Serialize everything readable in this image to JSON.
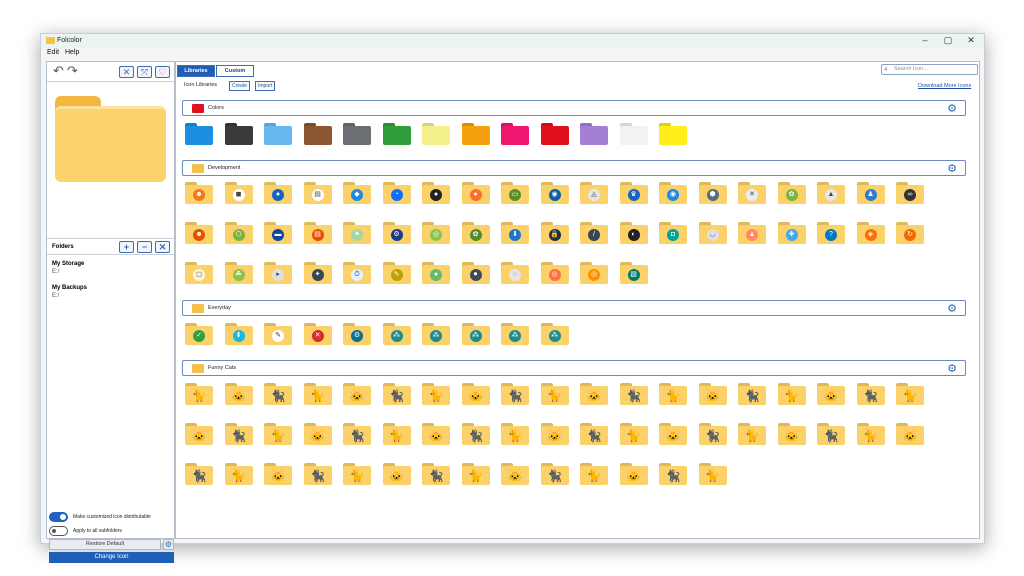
{
  "window": {
    "title": "Folcolor",
    "min": "–",
    "max": "▢",
    "close": "✕"
  },
  "menu": {
    "edit": "Edit",
    "help": "Help"
  },
  "sidebar": {
    "undo": "↶",
    "redo": "↷",
    "tool_icons": [
      "✕",
      "⤧",
      "♡"
    ],
    "folders_title": "Folders",
    "folder_actions": [
      "+",
      "−",
      "✕"
    ],
    "folders": [
      {
        "name": "My Storage",
        "path": "E:/"
      },
      {
        "name": "My Backups",
        "path": "E:/"
      }
    ],
    "toggle1_label": "Make customized icon distributable",
    "toggle2_label": "Apply to all subfolders",
    "restore_label": "Restore Default",
    "change_label": "Change Icon"
  },
  "main": {
    "tabs": [
      "Libraries",
      "Custom"
    ],
    "search_placeholder": "Search Icon...",
    "search_icon": "⌕",
    "icon_libraries_label": "Icon Libraries",
    "create_label": "Create",
    "import_label": "Import",
    "download_label": "Download More Icons",
    "gear": "⚙"
  },
  "sections": [
    {
      "name": "Colors",
      "icon_color": "#e0101d",
      "colors": [
        "#1b8fe0",
        "#3a3a3a",
        "#66b9ee",
        "#8b5630",
        "#6b6e73",
        "#2e9d3a",
        "#f3f08a",
        "#f5a00f",
        "#ef1770",
        "#e0101d",
        "#a57ed6",
        "#f2f2f2",
        "#ffee1a"
      ]
    },
    {
      "name": "Development",
      "icon_color": "#f5a623",
      "badge_colors": [
        "#f07a1c",
        "#ffffff",
        "#1565c0",
        "#ffffff",
        "#1e88e5",
        "#0d6efd",
        "#222222",
        "#ff6b2b",
        "#5a8f29",
        "#0b5ea8",
        "#e6e6e6",
        "#1565c0",
        "#1e88e5",
        "#546e7a",
        "#e8eef4",
        "#7cb342",
        "#e6e6e6",
        "#2b7cd3",
        "#333333",
        "#e65100",
        "#7cb342",
        "#0d47a1",
        "#e65100",
        "#a5d6a7",
        "#1e3a8a",
        "#8bc34a",
        "#558b2f",
        "#1976d2",
        "#1e2f4a",
        "#37474f",
        "#222222",
        "#00a29a",
        "#e0e0e0",
        "#ff8a65",
        "#42a5f5",
        "#0277bd",
        "#ff6f00",
        "#ef6c00",
        "#fff3e0",
        "#8bc34a",
        "#e0e0e0",
        "#37474f",
        "#e3f2fd",
        "#c0a000",
        "#66bb6a",
        "#3e4a5a",
        "#e6e6e6",
        "#ff7043",
        "#ff8f00",
        "#00796b"
      ],
      "badge_glyphs": [
        "☻",
        "◼",
        "●",
        "▤",
        "◆",
        "◔",
        "●",
        "●",
        "▭",
        "◉",
        "◬",
        "♛",
        "◉",
        "⬢",
        "✕",
        "✿",
        "▲",
        "♟",
        "∞",
        "☻",
        "⬡",
        "▬",
        "▤",
        "✦",
        "⚙",
        "◎",
        "✿",
        "⬇",
        "🔒",
        "/",
        "◐",
        "◘",
        "◡",
        "▲",
        "✚",
        "?",
        "◈",
        "↻",
        "◻",
        "☘",
        "▸",
        "✦",
        "⏱",
        "✎",
        "●",
        "⏺",
        "◌",
        "◎",
        "◎",
        "▧"
      ]
    },
    {
      "name": "Everyday",
      "icon_color": "#2ea043",
      "badge_colors": [
        "#2ea043",
        "#1ab7e0",
        "#ffffff",
        "#d32f2f",
        "#0d6e8f",
        "#1c8c8c",
        "#1c8c8c",
        "#1c8c8c",
        "#1c8c8c",
        "#1c8c8c"
      ],
      "badge_glyphs": [
        "✓",
        "⬇",
        "✎",
        "✕",
        "⚙",
        "⁂",
        "⁂",
        "⁂",
        "⁂",
        "⁂"
      ]
    },
    {
      "name": "Funny Cats",
      "icon_color": "#222222",
      "count_row1": 19,
      "count_row2": 19,
      "count_row3": 14
    }
  ]
}
